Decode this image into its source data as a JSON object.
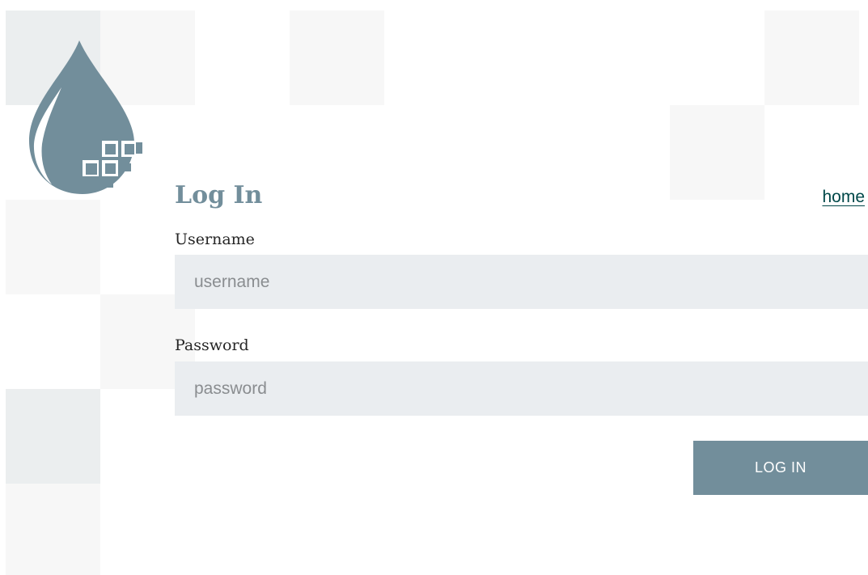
{
  "form": {
    "title": "Log In",
    "home_link": "home",
    "username": {
      "label": "Username",
      "placeholder": "username",
      "value": ""
    },
    "password": {
      "label": "Password",
      "placeholder": "password",
      "value": ""
    },
    "submit_label": "LOG IN"
  },
  "icons": {
    "logo": "water-drop-pixel-logo-icon"
  },
  "colors": {
    "accent": "#728e9b",
    "link": "#004849",
    "input_background": "#eaedf0",
    "tile_light": "#f7f7f7",
    "tile_mid": "#ebeeef"
  }
}
